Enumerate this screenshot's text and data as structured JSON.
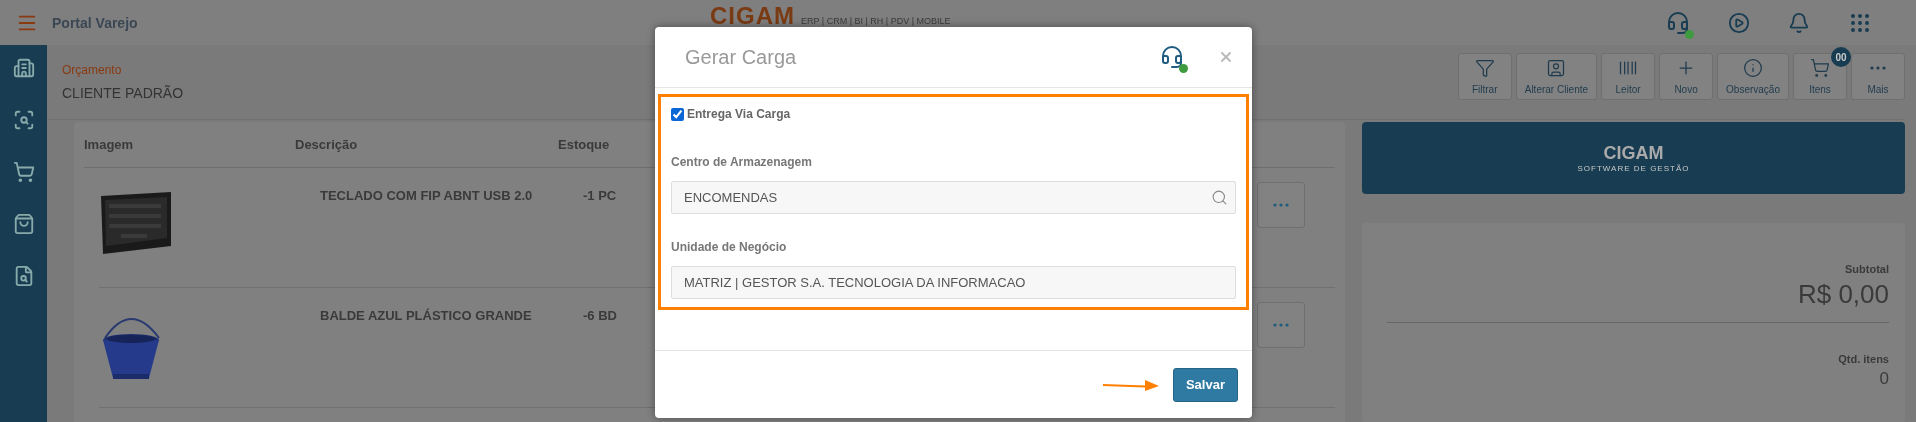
{
  "top_bar": {
    "app_title": "Portal Varejo",
    "logo": "CIGAM",
    "logo_subtitle": "ERP | CRM | BI | RH | PDV | MOBILE",
    "support_online": true
  },
  "header": {
    "breadcrumb": "Orçamento",
    "customer": "CLIENTE PADRÃO"
  },
  "toolbar": [
    {
      "label": "Filtrar"
    },
    {
      "label": "Alterar Cliente"
    },
    {
      "label": "Leitor"
    },
    {
      "label": "Novo"
    },
    {
      "label": "Observação"
    },
    {
      "label": "Itens",
      "badge": "00"
    },
    {
      "label": "Mais"
    }
  ],
  "table": {
    "columns": [
      "Imagem",
      "Descrição",
      "Estoque"
    ],
    "rows": [
      {
        "description": "TECLADO COM FIP ABNT USB 2.0",
        "stock": "-1 PC"
      },
      {
        "description": "BALDE AZUL PLÁSTICO GRANDE",
        "stock": "-6 BD"
      }
    ]
  },
  "summary": {
    "banner_logo": "CIGAM",
    "banner_tagline": "SOFTWARE DE GESTÃO",
    "subtotal_label": "Subtotal",
    "subtotal": "R$ 0,00",
    "items_label": "Qtd. itens",
    "items": "0"
  },
  "modal": {
    "title": "Gerar Carga",
    "support_online": true,
    "checkbox": {
      "label": "Entrega Via Carga",
      "checked": true
    },
    "fields": [
      {
        "label": "Centro de Armazenagem",
        "value": "ENCOMENDAS",
        "kind": "search"
      },
      {
        "label": "Unidade de Negócio",
        "value": "MATRIZ | GESTOR S.A. TECNOLOGIA DA INFORMACAO",
        "kind": "text"
      }
    ],
    "save_button": "Salvar"
  }
}
